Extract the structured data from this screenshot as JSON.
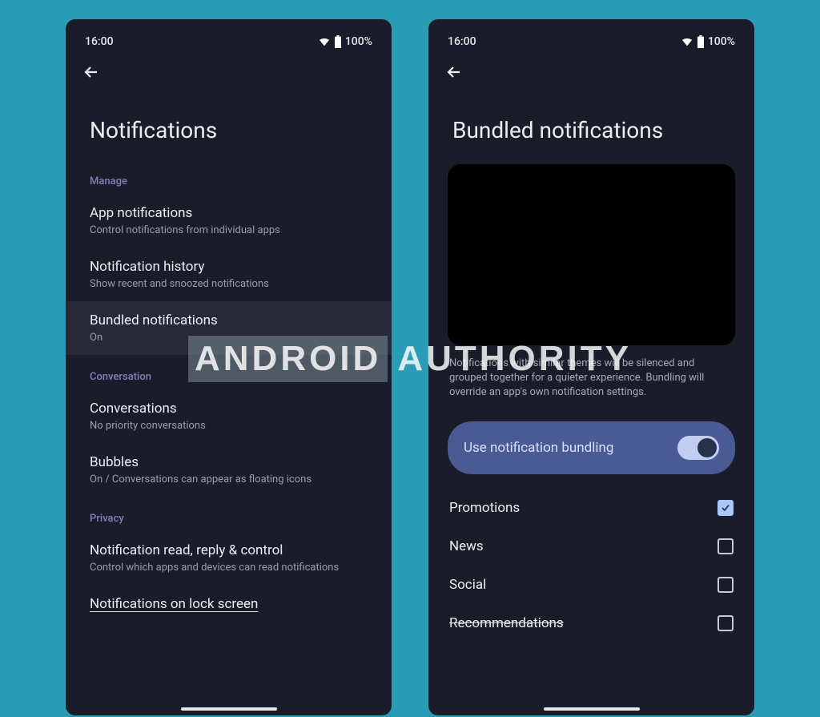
{
  "status": {
    "time": "16:00",
    "battery": "100%"
  },
  "left": {
    "title": "Notifications",
    "sections": {
      "manage_header": "Manage",
      "conversation_header": "Conversation",
      "privacy_header": "Privacy"
    },
    "items": {
      "app_notifications": {
        "title": "App notifications",
        "subtitle": "Control notifications from individual apps"
      },
      "notification_history": {
        "title": "Notification history",
        "subtitle": "Show recent and snoozed notifications"
      },
      "bundled_notifications": {
        "title": "Bundled notifications",
        "subtitle": "On"
      },
      "conversations": {
        "title": "Conversations",
        "subtitle": "No priority conversations"
      },
      "bubbles": {
        "title": "Bubbles",
        "subtitle": "On / Conversations can appear as floating icons"
      },
      "notification_read": {
        "title": "Notification read, reply & control",
        "subtitle": "Control which apps and devices can read notifications"
      },
      "lock_screen": {
        "title": "Notifications on lock screen"
      }
    }
  },
  "right": {
    "title": "Bundled notifications",
    "description": "Notifications with similar themes will be silenced and grouped together for a quieter experience. Bundling will override an app's own notification settings.",
    "toggle_label": "Use notification bundling",
    "toggle_on": true,
    "categories": {
      "promotions": {
        "label": "Promotions",
        "checked": true
      },
      "news": {
        "label": "News",
        "checked": false
      },
      "social": {
        "label": "Social",
        "checked": false
      },
      "recommendations": {
        "label": "Recommendations",
        "checked": false
      }
    }
  },
  "watermark": {
    "left": "ANDROID",
    "right": "AUTHORITY"
  }
}
